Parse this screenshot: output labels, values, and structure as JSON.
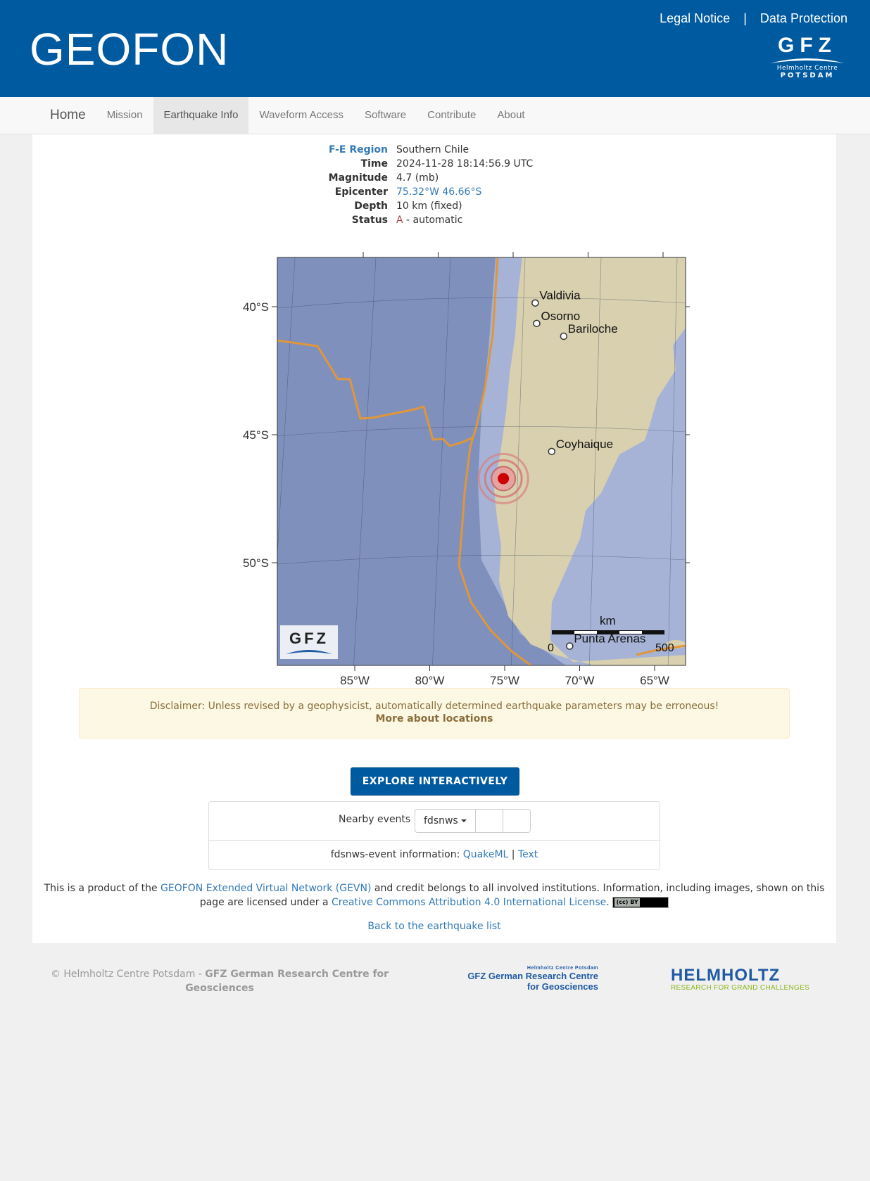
{
  "header": {
    "title": "GEOFON",
    "links": [
      "Legal Notice",
      "Data Protection"
    ],
    "separator": "|",
    "logo": {
      "mark": "GFZ",
      "line1": "Helmholtz Centre",
      "line2": "POTSDAM"
    }
  },
  "nav": {
    "brand": "Home",
    "items": [
      "Mission",
      "Earthquake Info",
      "Waveform Access",
      "Software",
      "Contribute",
      "About"
    ],
    "active": "Earthquake Info"
  },
  "event": {
    "region_label": "F-E Region",
    "region": "Southern Chile",
    "time_label": "Time",
    "time": "2024-11-28 18:14:56.9 UTC",
    "magnitude_label": "Magnitude",
    "magnitude": "4.7 (mb)",
    "epicenter_label": "Epicenter",
    "epicenter": "75.32°W 46.66°S",
    "depth_label": "Depth",
    "depth": "10 km (fixed)",
    "status_label": "Status",
    "status_code": "A",
    "status_text": " - automatic"
  },
  "map": {
    "lat_labels": [
      "40°S",
      "45°S",
      "50°S"
    ],
    "lon_labels": [
      "85°W",
      "80°W",
      "75°W",
      "70°W",
      "65°W"
    ],
    "cities": [
      {
        "name": "Valdivia",
        "lon": -73.2,
        "lat": -39.8
      },
      {
        "name": "Osorno",
        "lon": -73.1,
        "lat": -40.6
      },
      {
        "name": "Bariloche",
        "lon": -71.3,
        "lat": -41.1
      },
      {
        "name": "Coyhaique",
        "lon": -72.1,
        "lat": -45.6
      },
      {
        "name": "Punta Arenas",
        "lon": -70.9,
        "lat": -53.2
      }
    ],
    "event": {
      "lon": -75.32,
      "lat": -46.66
    },
    "scale": {
      "unit": "km",
      "start": "0",
      "end": "500"
    },
    "watermark": "GFZ",
    "colors": {
      "ocean": "#8a9ac4",
      "land": "#d9d3b4",
      "plate_boundary": "#e59a3a",
      "event": "#cc0000"
    }
  },
  "disclaimer": {
    "text": "Disclaimer: Unless revised by a geophysicist, automatically determined earthquake parameters may be erroneous!",
    "link": "More about locations"
  },
  "explore_button": "EXPLORE INTERACTIVELY",
  "nearby": {
    "label": "Nearby events",
    "dropdown": "fdsnws",
    "info_prefix": "fdsnws-event information:",
    "quakeml": "QuakeML",
    "sep": "|",
    "text": "Text"
  },
  "credit": {
    "p1": "This is a product of the ",
    "gevn_link": "GEOFON Extended Virtual Network (GEVN)",
    "p2": " and credit belongs to all involved institutions. Information, including images, shown on this page are licensed under a ",
    "cc_link": "Creative Commons Attribution 4.0 International License",
    "p3": ".",
    "badge": "(cc) BY"
  },
  "back_link": "Back to the earthquake list",
  "footer": {
    "copy_prefix": "© Helmholtz Centre Potsdam - ",
    "copy_bold": "GFZ German Research Centre for Geosciences",
    "gfz_logo_small": "Helmholtz Centre Potsdam",
    "gfz_logo_main1": "GFZ German Research Centre",
    "gfz_logo_main2": "for Geosciences",
    "helmholtz_name": "HELMHOLTZ",
    "helmholtz_tagline": "RESEARCH FOR GRAND CHALLENGES"
  }
}
